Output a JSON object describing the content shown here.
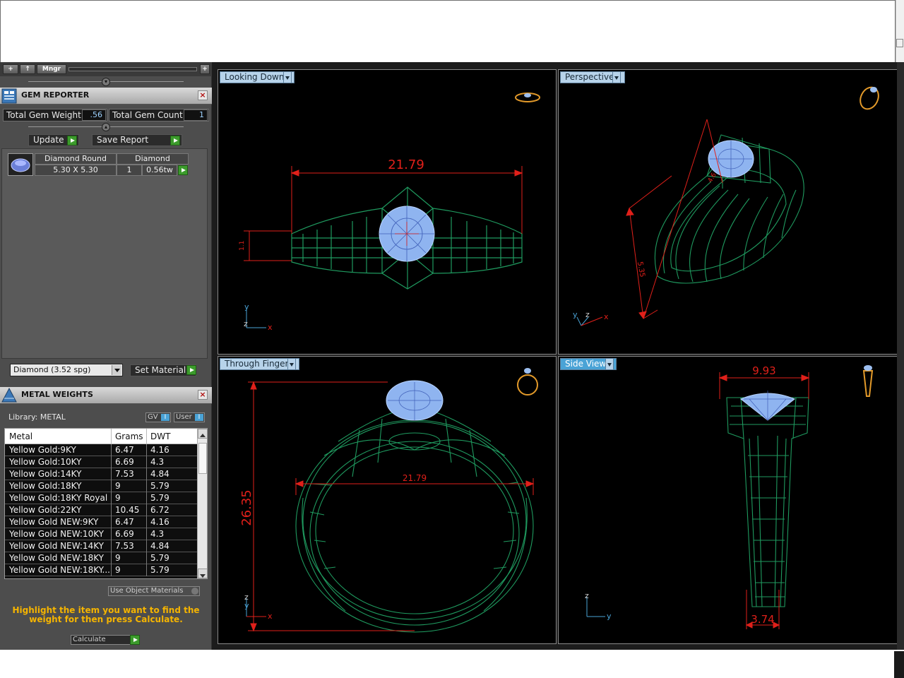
{
  "toolbar": {
    "btn1": "+",
    "btn2": "↑",
    "btn3": "Mngr",
    "btn4": "+"
  },
  "gem_reporter": {
    "title": "GEM REPORTER",
    "total_weight_label": "Total Gem Weight",
    "total_weight_value": ".56",
    "total_count_label": "Total Gem Count",
    "total_count_value": "1",
    "update_label": "Update",
    "save_report_label": "Save Report",
    "gem": {
      "name": "Diamond Round",
      "material": "Diamond",
      "size": "5.30 X 5.30",
      "count": "1",
      "weight": "0.56tw"
    },
    "material_select": "Diamond    (3.52 spg)",
    "set_material_label": "Set Material"
  },
  "metal_weights": {
    "title": "METAL WEIGHTS",
    "library_label": "Library: METAL",
    "gv_label": "GV",
    "user_label": "User",
    "toggle_indicator": "I",
    "columns": [
      "Metal",
      "Grams",
      "DWT"
    ],
    "rows": [
      {
        "metal": "Yellow Gold:9KY",
        "grams": "6.47",
        "dwt": "4.16"
      },
      {
        "metal": "Yellow Gold:10KY",
        "grams": "6.69",
        "dwt": "4.3"
      },
      {
        "metal": "Yellow Gold:14KY",
        "grams": "7.53",
        "dwt": "4.84"
      },
      {
        "metal": "Yellow Gold:18KY",
        "grams": "9",
        "dwt": "5.79"
      },
      {
        "metal": "Yellow Gold:18KY Royal",
        "grams": "9",
        "dwt": "5.79"
      },
      {
        "metal": "Yellow Gold:22KY",
        "grams": "10.45",
        "dwt": "6.72"
      },
      {
        "metal": "Yellow Gold NEW:9KY",
        "grams": "6.47",
        "dwt": "4.16"
      },
      {
        "metal": "Yellow Gold NEW:10KY",
        "grams": "6.69",
        "dwt": "4.3"
      },
      {
        "metal": "Yellow Gold NEW:14KY",
        "grams": "7.53",
        "dwt": "4.84"
      },
      {
        "metal": "Yellow Gold NEW:18KY",
        "grams": "9",
        "dwt": "5.79"
      },
      {
        "metal": "Yellow Gold NEW:18KY...",
        "grams": "9",
        "dwt": "5.79"
      }
    ],
    "use_object_materials": "Use Object Materials",
    "hint": "Highlight the item you want to find the weight for then press Calculate.",
    "calculate_label": "Calculate"
  },
  "viewports": {
    "looking_down": {
      "label": "Looking Down",
      "dimension": "21.79",
      "side_dim": "1.1",
      "axis_y": "y",
      "axis_z": "z",
      "axis_x": "x"
    },
    "perspective": {
      "label": "Perspective",
      "dim1": "5.35",
      "dim2": "4.6",
      "axis_y": "y",
      "axis_z": "z",
      "axis_x": "x"
    },
    "through_finger": {
      "label": "Through Finger",
      "height": "26.35",
      "width": "21.79",
      "axis_z": "z",
      "axis_y": "y",
      "axis_x": "x"
    },
    "side_view": {
      "label": "Side View",
      "top": "9.93",
      "bottom": "3.74",
      "axis_z": "z",
      "axis_y": "y"
    }
  },
  "colors": {
    "wire_green": "#1f9a5f",
    "gem_blue": "#9dbff0",
    "dim_red": "#e0201a",
    "gold_icon": "#e39a2a",
    "label_blue": "#4aa3d6"
  }
}
